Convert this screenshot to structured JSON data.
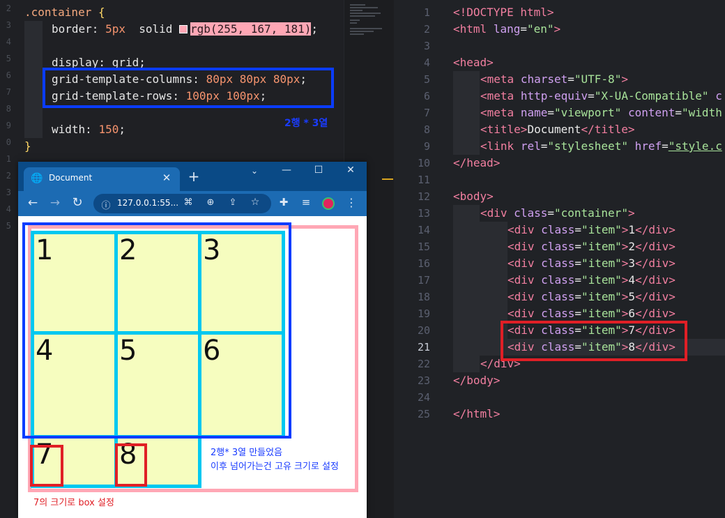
{
  "left_editor": {
    "selector": ".container",
    "open_brace": " {",
    "border_prop": "border: ",
    "border_num": "5px",
    "border_mid": "  solid ",
    "border_val": "rgb(255, 167, 181)",
    "semicolon": ";",
    "display_line": "display: grid;",
    "cols_prop": "grid-template-columns: ",
    "cols_val": "80px 80px 80px",
    "rows_prop": "grid-template-rows: ",
    "rows_val": "100px 100px",
    "width_prop": "width: ",
    "width_val": "150",
    "close_brace": "}",
    "note_blue": "2행 * 3열",
    "swatch_color": "#ffa7b5"
  },
  "right_editor": {
    "line_numbers": [
      "1",
      "2",
      "3",
      "4",
      "5",
      "6",
      "7",
      "8",
      "9",
      "10",
      "11",
      "12",
      "13",
      "14",
      "15",
      "16",
      "17",
      "18",
      "19",
      "20",
      "21",
      "22",
      "23",
      "24",
      "25"
    ],
    "active_line": "21"
  },
  "browser": {
    "tab_title": "Document",
    "new_tab": "+",
    "url": "127.0.0.1:55...",
    "items": [
      "1",
      "2",
      "3",
      "4",
      "5",
      "6",
      "7",
      "8"
    ],
    "note_blue_1": "2행* 3열 만들었음",
    "note_blue_2": "이후 넘어가는건 고유 크기로 설정",
    "note_red": "7의 크기로 box 설정"
  },
  "colors": {
    "pink_border": "#ffa7b5",
    "item_bg": "#f6fdbf",
    "item_border": "#00c8f0",
    "annotation_blue": "#0a3cff",
    "annotation_red": "#e01f26"
  }
}
